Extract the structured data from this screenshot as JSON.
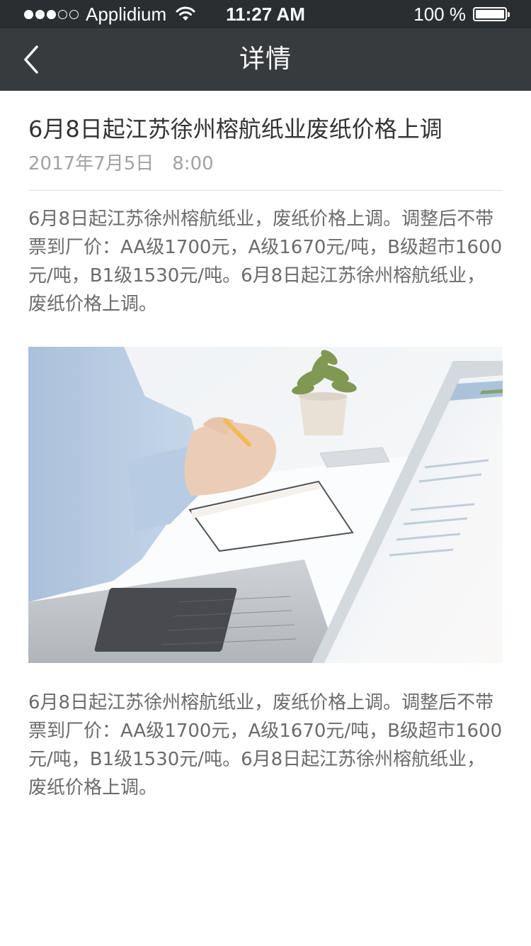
{
  "status_bar": {
    "carrier": "Applidium",
    "signal_filled": 3,
    "signal_total": 5,
    "time": "11:27 AM",
    "battery_text": "100 %",
    "battery_level": 1.0
  },
  "nav": {
    "title": "详情",
    "back_icon": "chevron-left-icon"
  },
  "article": {
    "title": "6月8日起江苏徐州榕航纸业废纸价格上调",
    "date": "2017年7月5日",
    "time": "8:00",
    "paragraph_1": "6月8日起江苏徐州榕航纸业，废纸价格上调。调整后不带票到厂价：AA级1700元，A级1670元/吨，B级超市1600元/吨，B1级1530元/吨。6月8日起江苏徐州榕航纸业，废纸价格上调。",
    "paragraph_2": "6月8日起江苏徐州榕航纸业，废纸价格上调。调整后不带票到厂价：AA级1700元，A级1670元/吨，B级超市1600元/吨，B1级1530元/吨。6月8日起江苏徐州榕航纸业，废纸价格上调。"
  },
  "colors": {
    "status_bar_bg": "#2b2e31",
    "nav_bg": "#373b3e",
    "title_text": "#333333",
    "meta_text": "#a2a2a2",
    "body_text": "#6b6b6b",
    "divider": "#dedede"
  }
}
